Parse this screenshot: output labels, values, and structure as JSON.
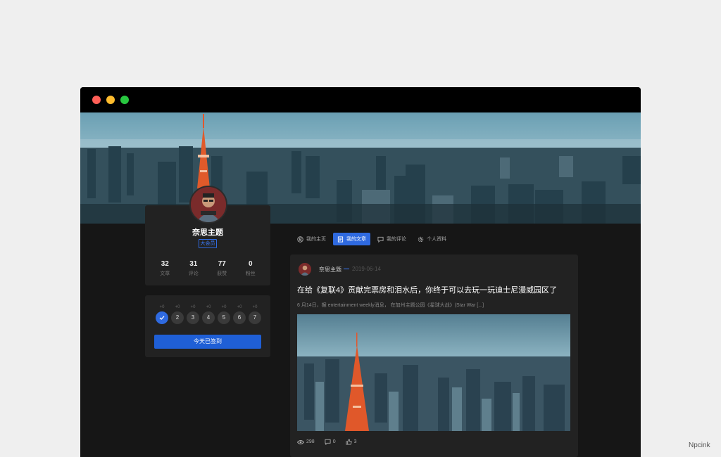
{
  "profile": {
    "username": "奈思主题",
    "badge": "大会员",
    "stats": [
      {
        "value": "32",
        "label": "文章"
      },
      {
        "value": "31",
        "label": "评论"
      },
      {
        "value": "77",
        "label": "获赞"
      },
      {
        "value": "0",
        "label": "粉丝"
      }
    ]
  },
  "checkin": {
    "days": [
      {
        "plus": "+0",
        "label": "",
        "done": true
      },
      {
        "plus": "+0",
        "label": "2",
        "done": false
      },
      {
        "plus": "+0",
        "label": "3",
        "done": false
      },
      {
        "plus": "+0",
        "label": "4",
        "done": false
      },
      {
        "plus": "+0",
        "label": "5",
        "done": false
      },
      {
        "plus": "+0",
        "label": "6",
        "done": false
      },
      {
        "plus": "+0",
        "label": "7",
        "done": false
      }
    ],
    "button_label": "今天已签到"
  },
  "tabs": [
    {
      "label": "我的主页",
      "icon": "user-circle-icon",
      "active": false
    },
    {
      "label": "我的文章",
      "icon": "document-icon",
      "active": true
    },
    {
      "label": "我的评论",
      "icon": "comment-icon",
      "active": false
    },
    {
      "label": "个人资料",
      "icon": "gear-icon",
      "active": false
    }
  ],
  "article": {
    "author": "奈思主题",
    "date": "2019-06-14",
    "title": "在给《复联4》贡献完票房和泪水后，你终于可以去玩一玩迪士尼漫威园区了",
    "excerpt": "6 月14日，据 entertainment weekly消息， 在加州主题公园《星球大战》(Star War [...]",
    "views": "298",
    "comments": "0",
    "likes": "3"
  },
  "watermark": "Npcink",
  "colors": {
    "accent": "#2f6ae0",
    "card": "#222222",
    "background": "#161616"
  }
}
